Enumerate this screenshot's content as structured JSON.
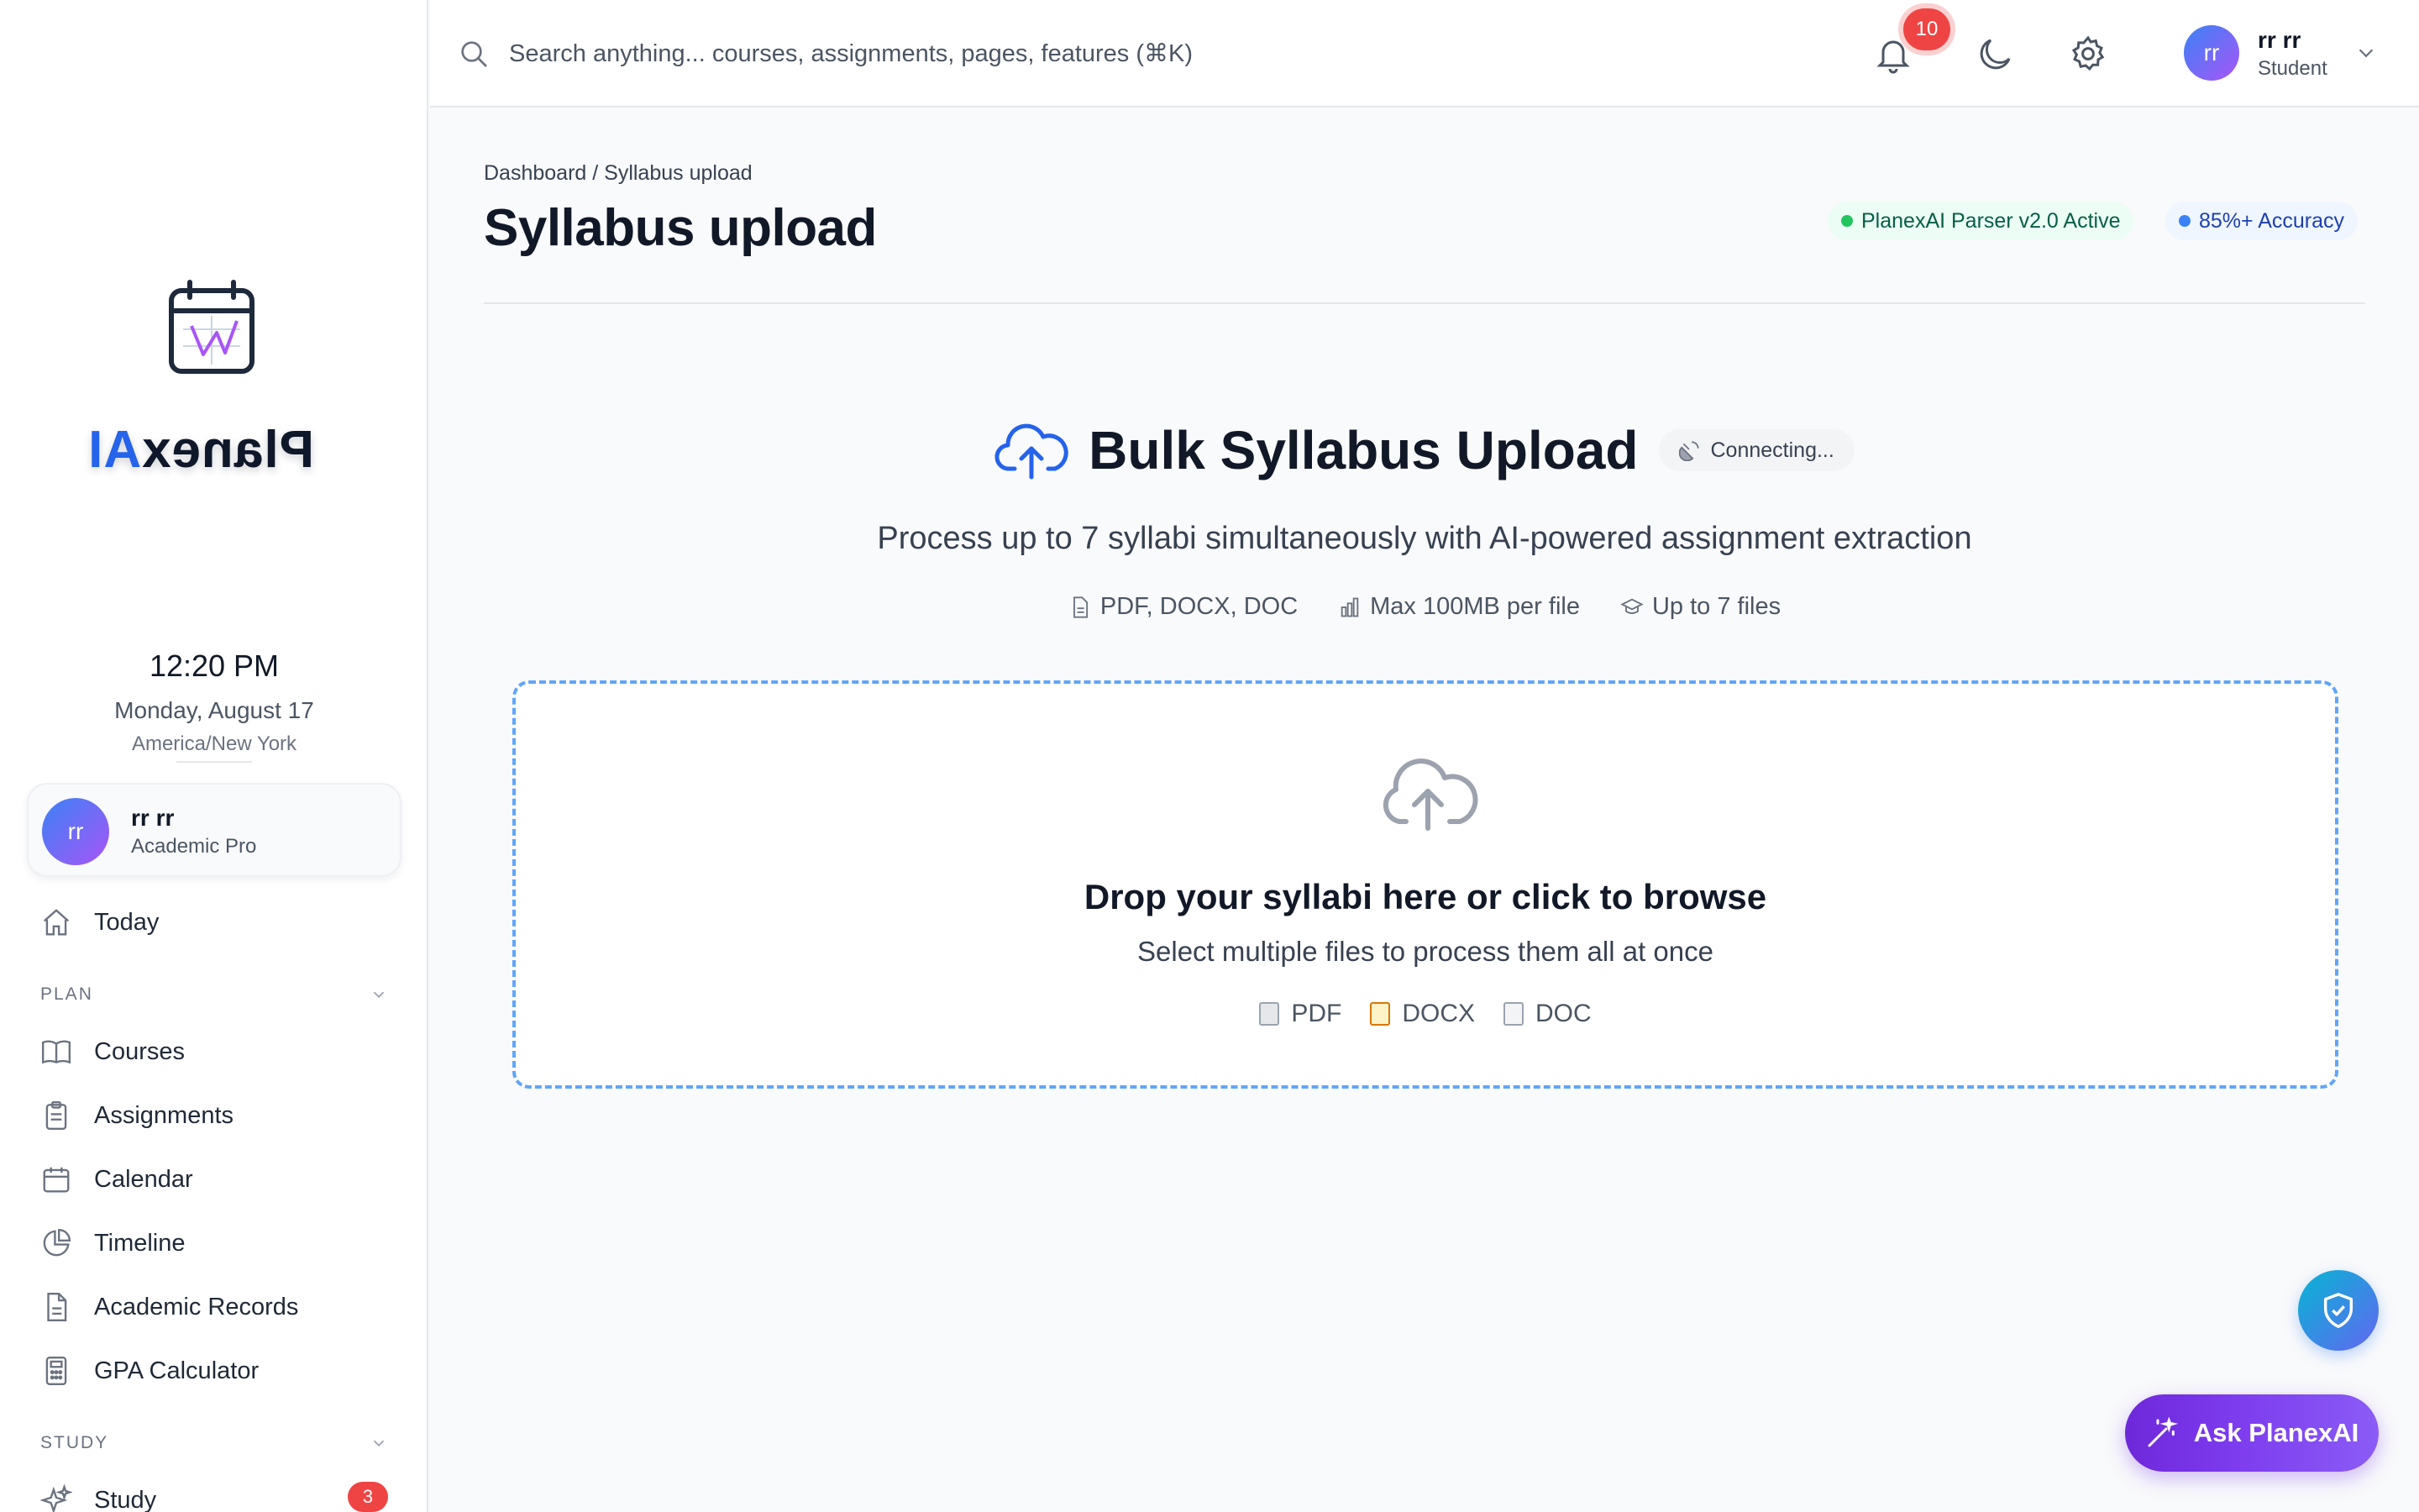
{
  "brand": {
    "name_main": "Planex",
    "name_accent": "AI"
  },
  "clock": {
    "time": "12:20 PM",
    "date": "Monday, August 17",
    "timezone": "America/New York"
  },
  "profile": {
    "initials": "rr",
    "name": "rr rr",
    "plan": "Academic Pro"
  },
  "nav": {
    "today": "Today",
    "plan_section": "PLAN",
    "plan_items": [
      "Courses",
      "Assignments",
      "Calendar",
      "Timeline",
      "Academic Records",
      "GPA Calculator"
    ],
    "study_section": "STUDY",
    "study_item": "Study",
    "study_badge": "3"
  },
  "topbar": {
    "search_placeholder": "Search anything... courses, assignments, pages, features (⌘K)",
    "notification_count": "10",
    "user_initials": "rr",
    "user_name": "rr rr",
    "user_role": "Student"
  },
  "page": {
    "breadcrumb": "Dashboard / Syllabus upload",
    "title": "Syllabus upload",
    "badge_parser": "PlanexAI Parser v2.0 Active",
    "badge_accuracy": "85%+ Accuracy"
  },
  "upload": {
    "heading": "Bulk Syllabus Upload",
    "status": "Connecting...",
    "subtitle": "Process up to 7 syllabi simultaneously with AI-powered assignment extraction",
    "spec_formats": "PDF, DOCX, DOC",
    "spec_size": "Max 100MB per file",
    "spec_count": "Up to 7 files",
    "drop_title": "Drop your syllabi here or click to browse",
    "drop_subtitle": "Select multiple files to process them all at once",
    "types": [
      "PDF",
      "DOCX",
      "DOC"
    ]
  },
  "assistant": {
    "label": "Ask PlanexAI"
  },
  "colors": {
    "accent": "#2563eb",
    "purple": "#7c3aed",
    "danger": "#ef4444",
    "success": "#22c55e"
  }
}
